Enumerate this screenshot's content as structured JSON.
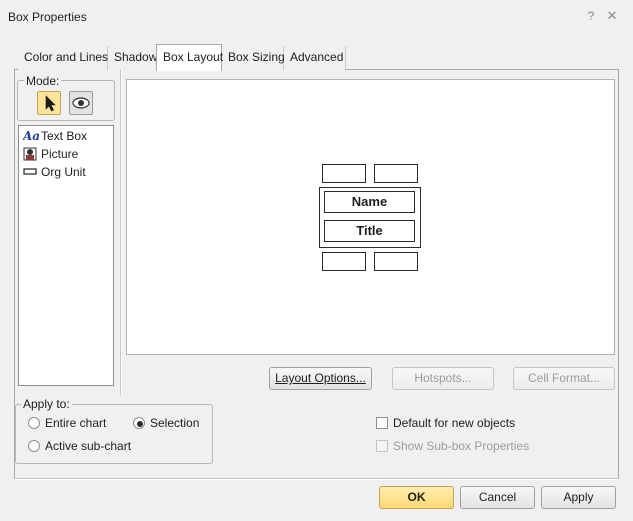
{
  "window": {
    "title": "Box Properties",
    "help_icon": "?",
    "close_icon": "✕"
  },
  "tabs": [
    {
      "label": "Color and Lines",
      "active": false
    },
    {
      "label": "Shadow",
      "active": false
    },
    {
      "label": "Box Layout",
      "active": true
    },
    {
      "label": "Box Sizing",
      "active": false
    },
    {
      "label": "Advanced",
      "active": false
    }
  ],
  "mode": {
    "legend": "Mode:",
    "select_icon": "arrow-cursor-icon",
    "preview_icon": "eye-icon"
  },
  "toolbox": {
    "items": [
      {
        "label": "Text Box",
        "icon": "text-box-icon"
      },
      {
        "label": "Picture",
        "icon": "picture-icon"
      },
      {
        "label": "Org Unit",
        "icon": "org-unit-icon"
      }
    ]
  },
  "preview": {
    "name_field": "Name",
    "title_field": "Title"
  },
  "buttons": {
    "layout_options": "Layout Options...",
    "hotspots": "Hotspots...",
    "cell_format": "Cell Format...",
    "ok": "OK",
    "cancel": "Cancel",
    "apply": "Apply"
  },
  "apply_to": {
    "legend": "Apply to:",
    "entire_chart": "Entire chart",
    "selection": "Selection",
    "active_sub_chart": "Active sub-chart",
    "selected": "selection"
  },
  "options": {
    "default_new_objects": "Default for new objects",
    "show_subbox_properties": "Show Sub-box Properties"
  }
}
